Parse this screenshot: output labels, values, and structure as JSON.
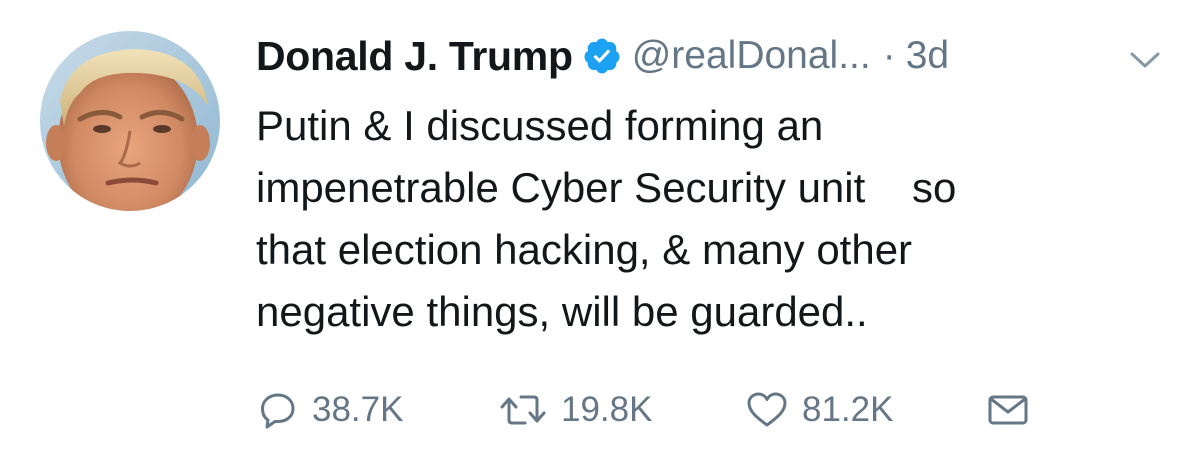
{
  "tweet": {
    "author": {
      "name": "Donald J. Trump",
      "handle": "@realDonal...",
      "verified": true,
      "avatar": "profile-photo"
    },
    "separator": "·",
    "timestamp": "3d",
    "text_lines": [
      "Putin & I discussed forming an",
      "impenetrable Cyber Security unit    so",
      "that election hacking, & many other",
      "negative things, will be guarded.."
    ],
    "actions": {
      "reply": {
        "icon": "reply-icon",
        "count": "38.7K"
      },
      "retweet": {
        "icon": "retweet-icon",
        "count": "19.8K"
      },
      "like": {
        "icon": "heart-icon",
        "count": "81.2K"
      },
      "message": {
        "icon": "envelope-icon"
      }
    },
    "menu_icon": "chevron-down-icon"
  },
  "colors": {
    "text_primary": "#14171a",
    "text_secondary": "#657786",
    "verified_blue": "#1da1f2",
    "background": "#ffffff"
  }
}
